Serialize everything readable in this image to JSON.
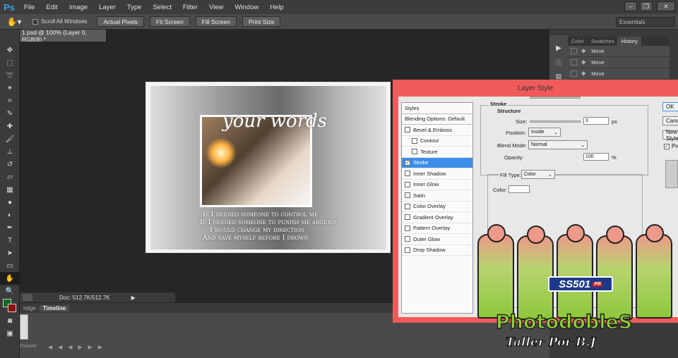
{
  "app": {
    "logo": "Ps"
  },
  "menubar": {
    "items": [
      "File",
      "Edit",
      "Image",
      "Layer",
      "Type",
      "Select",
      "Filter",
      "View",
      "Window",
      "Help"
    ]
  },
  "window_controls": [
    "–",
    "❐",
    "✕"
  ],
  "options_bar": {
    "scroll_all_windows": "Scroll All Windows",
    "buttons": [
      "Actual Pixels",
      "Fit Screen",
      "Fill Screen",
      "Print Size"
    ],
    "workspace": "Essentials"
  },
  "document": {
    "tab_title": "1.psd @ 100% (Layer 0, RGB/8) *"
  },
  "artwork": {
    "title": "your words",
    "lines": [
      "If I needed someone to control me",
      "If I needed someone to punish me around",
      "I would change my direction",
      "And save myself before I drown"
    ]
  },
  "status": {
    "zoom": "",
    "doc_info": "Doc: 512.7K/512.7K"
  },
  "bottom_tabs": [
    "ridge",
    "Timeline"
  ],
  "timeline": {
    "zoom_label": "Forever"
  },
  "right_panel": {
    "tabs": [
      "Color",
      "Swatches",
      "History"
    ],
    "history": [
      "Move",
      "Move",
      "Move"
    ]
  },
  "layer_style": {
    "title": "Layer Style",
    "styles": [
      {
        "label": "Styles",
        "type": "header"
      },
      {
        "label": "Blending Options: Default",
        "type": "header"
      },
      {
        "label": "Bevel & Emboss",
        "checked": false
      },
      {
        "label": "Contour",
        "checked": false,
        "indent": true
      },
      {
        "label": "Texture",
        "checked": false,
        "indent": true
      },
      {
        "label": "Stroke",
        "checked": true,
        "selected": true
      },
      {
        "label": "Inner Shadow",
        "checked": false
      },
      {
        "label": "Inner Glow",
        "checked": false
      },
      {
        "label": "Satin",
        "checked": false
      },
      {
        "label": "Color Overlay",
        "checked": false
      },
      {
        "label": "Gradient Overlay",
        "checked": false
      },
      {
        "label": "Pattern Overlay",
        "checked": false
      },
      {
        "label": "Outer Glow",
        "checked": false
      },
      {
        "label": "Drop Shadow",
        "checked": false
      }
    ],
    "stroke": {
      "section": "Stroke",
      "structure": "Structure",
      "size_label": "Size:",
      "size_value": "3",
      "size_unit": "px",
      "position_label": "Position:",
      "position_value": "Inside",
      "blend_label": "Blend Mode:",
      "blend_value": "Normal",
      "opacity_label": "Opacity:",
      "opacity_value": "100",
      "opacity_unit": "%",
      "fill_type_label": "Fill Type:",
      "fill_type_value": "Color",
      "color_label": "Color:"
    },
    "buttons": [
      "OK",
      "Cancel",
      "New Style...",
      "Preview"
    ]
  },
  "watermark": {
    "logo": "SS501",
    "logo_tag": "PR",
    "title": "PhotodobleS",
    "subtitle": "Taller Por B.J"
  }
}
